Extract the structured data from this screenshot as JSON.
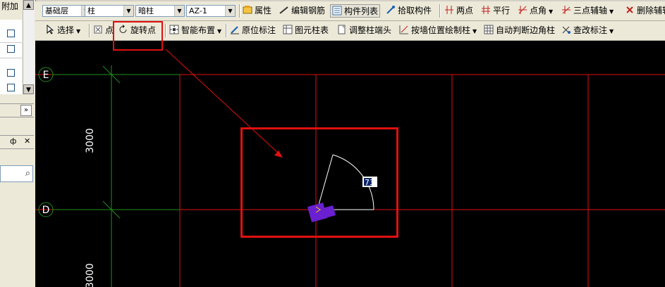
{
  "left_panel": {
    "header": "附加",
    "expand_label": "»",
    "pin_label": "ф",
    "close_label": "✕",
    "scroll_down": "▼",
    "scroll_up": "▲"
  },
  "toolbar1": {
    "floor_select": "基础层",
    "type_select": "柱",
    "subtype_select": "暗柱",
    "component_select": "AZ-1",
    "properties": "属性",
    "edit_rebar": "编辑钢筋",
    "component_list": "构件列表",
    "pick_component": "拾取构件",
    "two_points": "两点",
    "parallel": "平行",
    "point_angle": "点角",
    "three_point_axis": "三点辅轴",
    "delete_axis": "删除辅轴"
  },
  "toolbar2": {
    "select": "选择",
    "point": "点",
    "rotate_point": "旋转点",
    "smart_layout": "智能布置",
    "original_mark": "原位标注",
    "element_column_table": "图元柱表",
    "adjust_column_end": "调整柱端头",
    "draw_by_wall": "按墙位置绘制柱",
    "auto_corner_column": "自动判断边角柱",
    "modify_mark": "查改标注"
  },
  "canvas": {
    "axis_E": "E",
    "axis_D": "D",
    "dim_top": "3000",
    "dim_bottom": "3000",
    "angle_value": "73"
  },
  "colors": {
    "grid_red": "#e01010",
    "axis_green": "#1f8f1f",
    "column_purple": "#6a1fd0",
    "annotation_red": "#e01010"
  }
}
